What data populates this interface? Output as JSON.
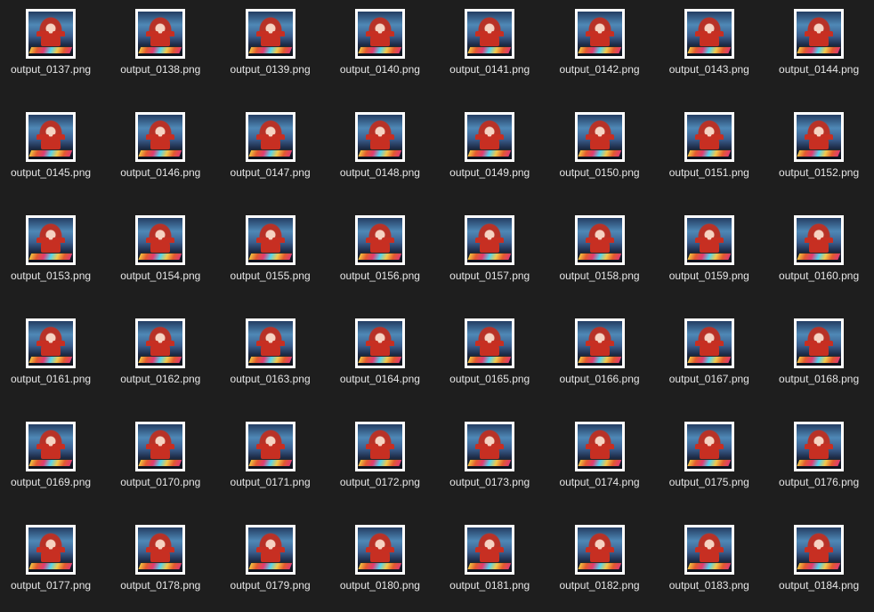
{
  "file_grid": {
    "items": [
      {
        "name": "output_0137.png"
      },
      {
        "name": "output_0138.png"
      },
      {
        "name": "output_0139.png"
      },
      {
        "name": "output_0140.png"
      },
      {
        "name": "output_0141.png"
      },
      {
        "name": "output_0142.png"
      },
      {
        "name": "output_0143.png"
      },
      {
        "name": "output_0144.png"
      },
      {
        "name": "output_0145.png"
      },
      {
        "name": "output_0146.png"
      },
      {
        "name": "output_0147.png"
      },
      {
        "name": "output_0148.png"
      },
      {
        "name": "output_0149.png"
      },
      {
        "name": "output_0150.png"
      },
      {
        "name": "output_0151.png"
      },
      {
        "name": "output_0152.png"
      },
      {
        "name": "output_0153.png"
      },
      {
        "name": "output_0154.png"
      },
      {
        "name": "output_0155.png"
      },
      {
        "name": "output_0156.png"
      },
      {
        "name": "output_0157.png"
      },
      {
        "name": "output_0158.png"
      },
      {
        "name": "output_0159.png"
      },
      {
        "name": "output_0160.png"
      },
      {
        "name": "output_0161.png"
      },
      {
        "name": "output_0162.png"
      },
      {
        "name": "output_0163.png"
      },
      {
        "name": "output_0164.png"
      },
      {
        "name": "output_0165.png"
      },
      {
        "name": "output_0166.png"
      },
      {
        "name": "output_0167.png"
      },
      {
        "name": "output_0168.png"
      },
      {
        "name": "output_0169.png"
      },
      {
        "name": "output_0170.png"
      },
      {
        "name": "output_0171.png"
      },
      {
        "name": "output_0172.png"
      },
      {
        "name": "output_0173.png"
      },
      {
        "name": "output_0174.png"
      },
      {
        "name": "output_0175.png"
      },
      {
        "name": "output_0176.png"
      },
      {
        "name": "output_0177.png"
      },
      {
        "name": "output_0178.png"
      },
      {
        "name": "output_0179.png"
      },
      {
        "name": "output_0180.png"
      },
      {
        "name": "output_0181.png"
      },
      {
        "name": "output_0182.png"
      },
      {
        "name": "output_0183.png"
      },
      {
        "name": "output_0184.png"
      }
    ]
  },
  "theme": {
    "background": "#1e1e1e",
    "label_color": "#e6e6e6",
    "thumb_border": "#ffffff"
  }
}
